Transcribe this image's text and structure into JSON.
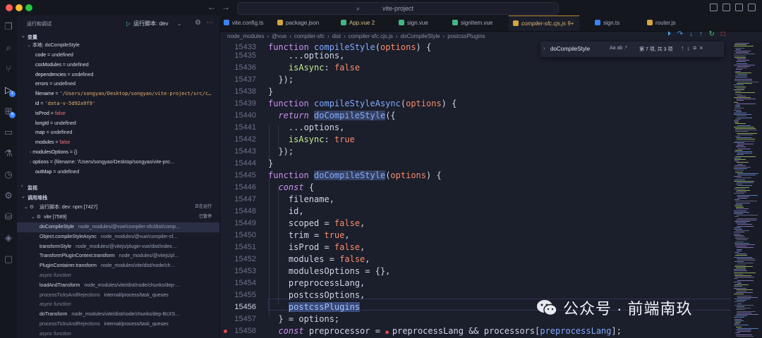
{
  "window": {
    "title": "vite-project"
  },
  "sidebar": {
    "title": "运行和调试",
    "run_config": "运行脚本: dev",
    "variables_header": "变量",
    "local_scope": "本地: doCompileStyle",
    "variables": [
      {
        "name": "code",
        "value": "undefined",
        "kind": "plain"
      },
      {
        "name": "cssModules",
        "value": "undefined",
        "kind": "plain"
      },
      {
        "name": "dependencies",
        "value": "undefined",
        "kind": "plain"
      },
      {
        "name": "errors",
        "value": "undefined",
        "kind": "plain"
      },
      {
        "name": "filename",
        "value": "'/Users/songyao/Desktop/songyao/vite-project/src/c…",
        "kind": "str"
      },
      {
        "name": "id",
        "value": "'data-v-5d92a9f9'",
        "kind": "str"
      },
      {
        "name": "isProd",
        "value": "false",
        "kind": "fal"
      },
      {
        "name": "longId",
        "value": "undefined",
        "kind": "plain"
      },
      {
        "name": "map",
        "value": "undefined",
        "kind": "plain"
      },
      {
        "name": "modules",
        "value": "false",
        "kind": "fal"
      },
      {
        "name": "modulesOptions",
        "value": "{}",
        "kind": "plain",
        "expandable": true
      },
      {
        "name": "options",
        "value": "{filename: '/Users/songyao/Desktop/songyao/vite-pro…",
        "kind": "plain",
        "expandable": true
      },
      {
        "name": "outMap",
        "value": "undefined",
        "kind": "plain"
      }
    ],
    "watch_header": "监视",
    "callstack_header": "调用堆栈",
    "session": {
      "label": "运行脚本: dev: npm [7427]",
      "status": "正在运行"
    },
    "thread": {
      "label": "vite [7589]",
      "status": "已暂停"
    },
    "frames": [
      {
        "fn": "doCompileStyle",
        "path": "node_modules/@vue/compiler-sfc/dist/comp…",
        "type": "active"
      },
      {
        "fn": "Object.compileStyleAsync",
        "path": "node_modules/@vue/compiler-sf…",
        "type": "normal"
      },
      {
        "fn": "transformStyle",
        "path": "node_modules/@vitejs/plugin-vue/dist/index…",
        "type": "normal"
      },
      {
        "fn": "TransformPluginContext.transform",
        "path": "node_modules/@vitejs/pl…",
        "type": "normal"
      },
      {
        "fn": "PluginContainer.transform",
        "path": "node_modules/vite/dist/node/ch…",
        "type": "normal"
      },
      {
        "fn": "async function",
        "path": "",
        "type": "async"
      },
      {
        "fn": "loadAndTransform",
        "path": "node_modules/vite/dist/node/chunks/dep-…",
        "type": "normal"
      },
      {
        "fn": "processTicksAndRejections",
        "path": "internal/process/task_queues",
        "type": "dim"
      },
      {
        "fn": "async function",
        "path": "",
        "type": "async"
      },
      {
        "fn": "doTransform",
        "path": "node_modules/vite/dist/node/chunks/dep-BcXS…",
        "type": "normal"
      },
      {
        "fn": "processTicksAndRejections",
        "path": "internal/process/task_queues",
        "type": "dim"
      },
      {
        "fn": "async function",
        "path": "",
        "type": "async"
      },
      {
        "fn": "transformRequest",
        "path": "node_modules/vite/dist/node/chunks/dep-…",
        "type": "normal"
      }
    ]
  },
  "tabs": [
    {
      "label": "vite.config.ts",
      "color": "#3b82f6"
    },
    {
      "label": "package.json",
      "color": "#d4a63c"
    },
    {
      "label": "App.vue 2",
      "color": "#42b883"
    },
    {
      "label": "sign.vue",
      "color": "#42b883"
    },
    {
      "label": "signItem.vue",
      "color": "#42b883"
    },
    {
      "label": "compiler-sfc.cjs.js 9+",
      "color": "#d4a63c",
      "active": true
    },
    {
      "label": "sign.ts",
      "color": "#3b82f6"
    },
    {
      "label": "router.js",
      "color": "#d4a63c"
    }
  ],
  "breadcrumb": [
    "node_modules",
    "@vue",
    "compiler-sfc",
    "dist",
    "compiler-sfc.cjs.js",
    "doCompileStyle",
    "postcssPlugins"
  ],
  "find": {
    "query": "doCompileStyle",
    "options": "Aa  ab  .*",
    "count": "第 7 项, 共 3 项"
  },
  "code_lines": [
    {
      "n": "15435",
      "tokens": [
        [
          "    ...options,",
          "p"
        ]
      ]
    },
    {
      "n": "15436",
      "tokens": [
        [
          "    ",
          "p"
        ],
        [
          "isAsync",
          "prop"
        ],
        [
          ": ",
          "p"
        ],
        [
          "false",
          "bool"
        ]
      ]
    },
    {
      "n": "15437",
      "tokens": [
        [
          "  });",
          "p"
        ]
      ]
    },
    {
      "n": "15438",
      "tokens": [
        [
          "}",
          "p"
        ]
      ]
    },
    {
      "n": "15439",
      "tokens": [
        [
          "function ",
          "kw"
        ],
        [
          "compileStyleAsync",
          "fnn"
        ],
        [
          "(",
          "p"
        ],
        [
          "options",
          "prm"
        ],
        [
          ") {",
          "p"
        ]
      ]
    },
    {
      "n": "15440",
      "tokens": [
        [
          "  ",
          "p"
        ],
        [
          "return ",
          "kwit"
        ],
        [
          "doCompileStyle",
          "fnhl"
        ],
        [
          "({",
          "p"
        ]
      ]
    },
    {
      "n": "15441",
      "tokens": [
        [
          "    ...options,",
          "p"
        ]
      ]
    },
    {
      "n": "15442",
      "tokens": [
        [
          "    ",
          "p"
        ],
        [
          "isAsync",
          "prop"
        ],
        [
          ": ",
          "p"
        ],
        [
          "true",
          "bool"
        ]
      ]
    },
    {
      "n": "15443",
      "tokens": [
        [
          "  });",
          "p"
        ]
      ]
    },
    {
      "n": "15444",
      "tokens": [
        [
          "}",
          "p"
        ]
      ]
    },
    {
      "n": "15445",
      "tokens": [
        [
          "function ",
          "kw"
        ],
        [
          "doCompileStyle",
          "fnhl"
        ],
        [
          "(",
          "p"
        ],
        [
          "options",
          "prm"
        ],
        [
          ") {",
          "p"
        ]
      ]
    },
    {
      "n": "15446",
      "tokens": [
        [
          "  ",
          "p"
        ],
        [
          "const ",
          "kwit"
        ],
        [
          "{",
          "p"
        ]
      ]
    },
    {
      "n": "15447",
      "tokens": [
        [
          "    filename,",
          "p"
        ]
      ]
    },
    {
      "n": "15448",
      "tokens": [
        [
          "    id,",
          "p"
        ]
      ]
    },
    {
      "n": "15449",
      "tokens": [
        [
          "    scoped = ",
          "p"
        ],
        [
          "false",
          "bool"
        ],
        [
          ",",
          "p"
        ]
      ]
    },
    {
      "n": "15450",
      "tokens": [
        [
          "    trim = ",
          "p"
        ],
        [
          "true",
          "bool"
        ],
        [
          ",",
          "p"
        ]
      ]
    },
    {
      "n": "15451",
      "tokens": [
        [
          "    isProd = ",
          "p"
        ],
        [
          "false",
          "bool"
        ],
        [
          ",",
          "p"
        ]
      ]
    },
    {
      "n": "15452",
      "tokens": [
        [
          "    modules = ",
          "p"
        ],
        [
          "false",
          "bool"
        ],
        [
          ",",
          "p"
        ]
      ]
    },
    {
      "n": "15453",
      "tokens": [
        [
          "    modulesOptions = {},",
          "p"
        ]
      ]
    },
    {
      "n": "15454",
      "tokens": [
        [
          "    preprocessLang,",
          "p"
        ]
      ]
    },
    {
      "n": "15455",
      "tokens": [
        [
          "    postcssOptions,",
          "p"
        ]
      ]
    },
    {
      "n": "15456",
      "tokens": [
        [
          "    ",
          "p"
        ],
        [
          "postcssPlugins",
          "sel"
        ]
      ],
      "current": true
    },
    {
      "n": "15457",
      "tokens": [
        [
          "  } = options;",
          "p"
        ]
      ]
    },
    {
      "n": "15458",
      "tokens": [
        [
          "  ",
          "p"
        ],
        [
          "const ",
          "kwit"
        ],
        [
          "preprocessor = ",
          "p"
        ],
        [
          "● ",
          "bpdot"
        ],
        [
          "preprocessLang && processors[",
          "p"
        ],
        [
          "preprocessLang",
          "fnn"
        ],
        [
          "];",
          "p"
        ]
      ],
      "breakpoint": true
    }
  ],
  "code_top": {
    "n": "15433",
    "tokens": [
      [
        "function ",
        "kw"
      ],
      [
        "compileStyle",
        "fnn"
      ],
      [
        "(",
        "p"
      ],
      [
        "options",
        "prm"
      ],
      [
        ") {",
        "p"
      ]
    ]
  },
  "watermark": {
    "text": "公众号 · 前端南玖"
  }
}
